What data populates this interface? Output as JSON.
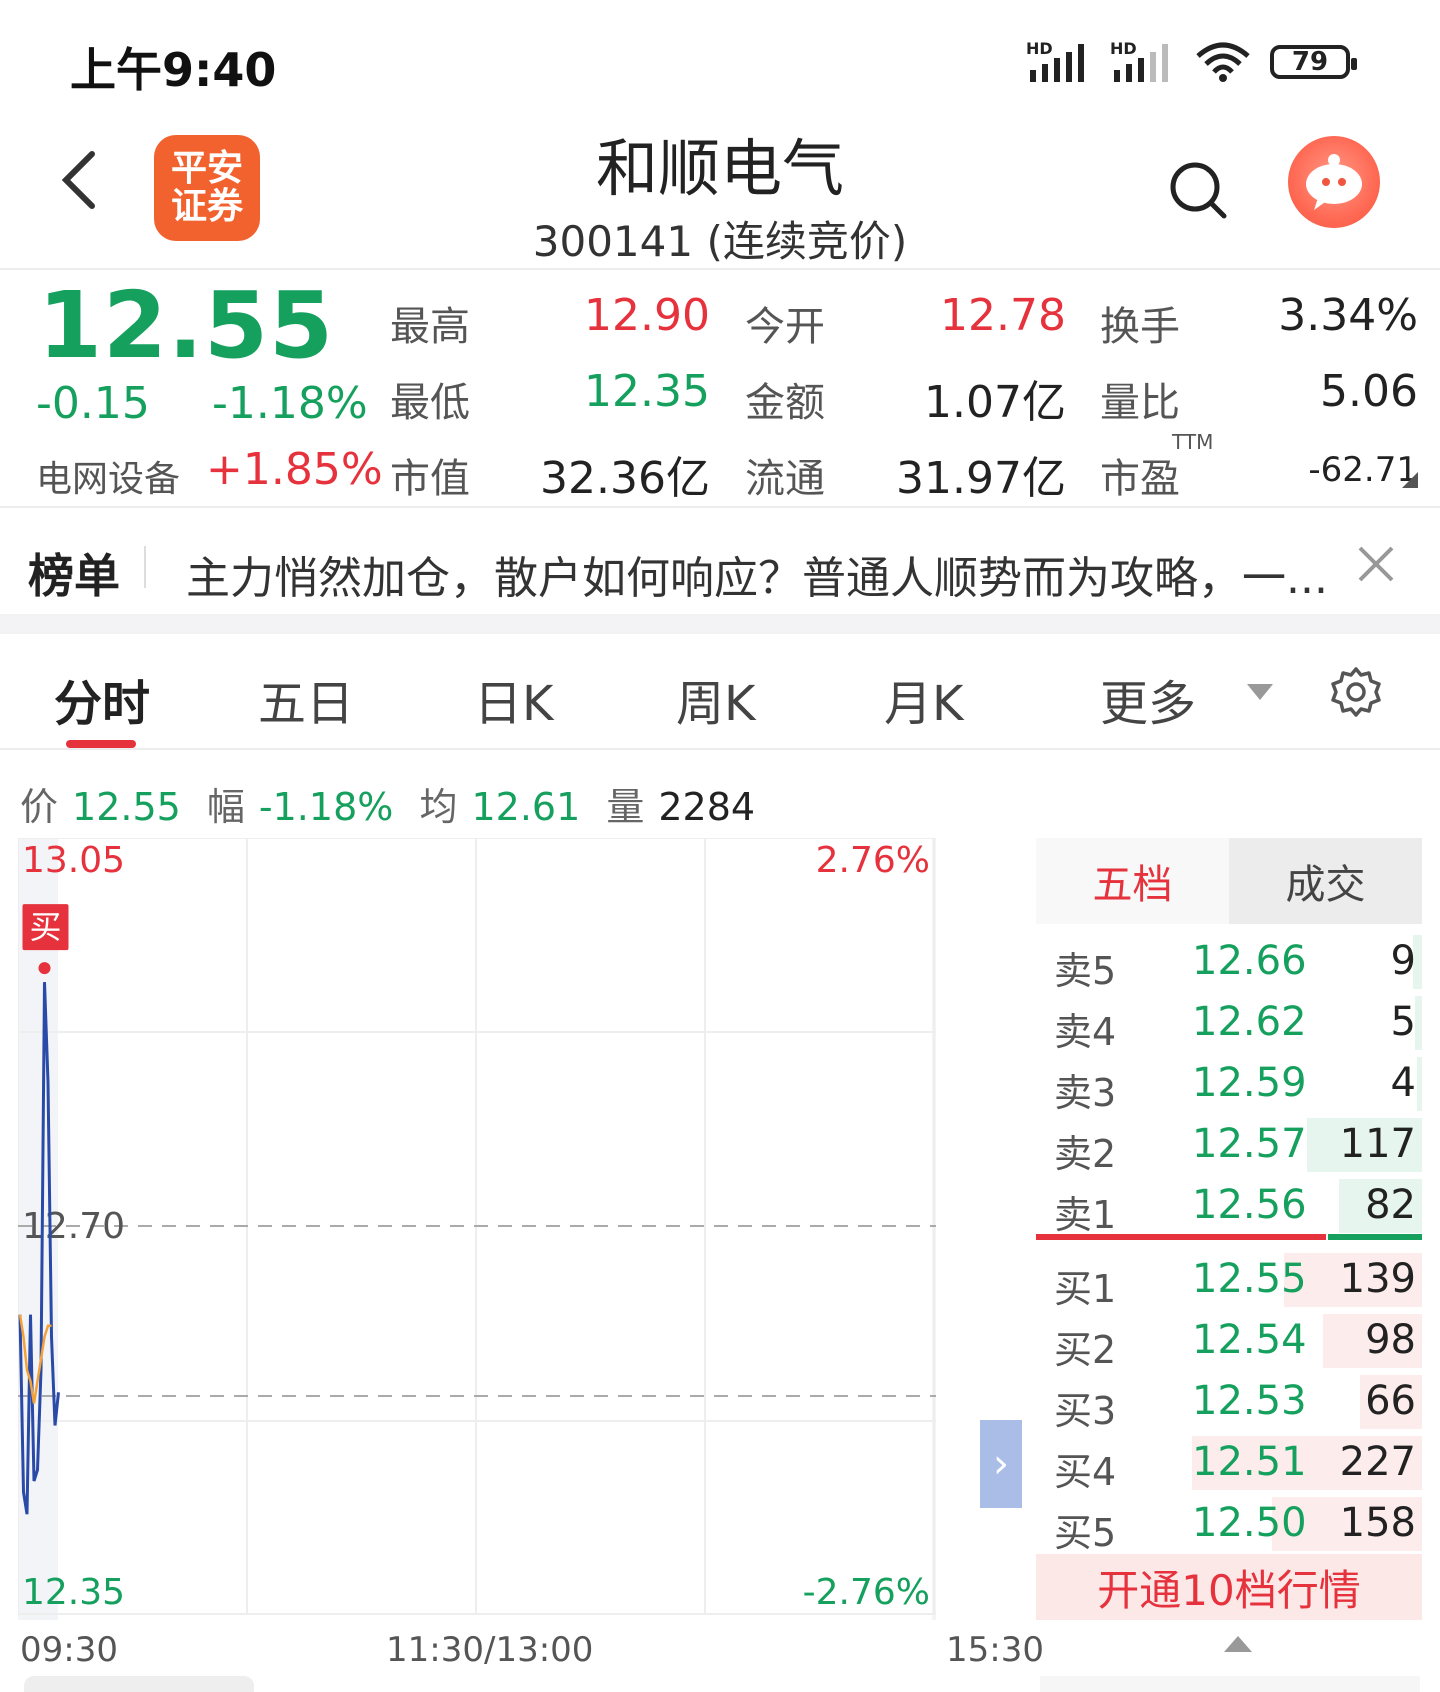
{
  "status": {
    "time": "上午9:40",
    "battery": "79",
    "sim1": "HD",
    "sim2": "HD"
  },
  "header": {
    "title": "和顺电气",
    "subtitle": "300141 (连续竞价)",
    "logo_line1": "平安",
    "logo_line2": "证券"
  },
  "quote": {
    "price": "12.55",
    "change": "-0.15",
    "change_pct": "-1.18%",
    "sector": "电网设备",
    "sector_pct": "+1.85%",
    "fields": [
      {
        "label": "最高",
        "value": "12.90",
        "color": "red"
      },
      {
        "label": "今开",
        "value": "12.78",
        "color": "red"
      },
      {
        "label": "换手",
        "value": "3.34%",
        "color": "dark"
      },
      {
        "label": "最低",
        "value": "12.35",
        "color": "green"
      },
      {
        "label": "金额",
        "value": "1.07亿",
        "color": "dark"
      },
      {
        "label": "量比",
        "value": "5.06",
        "color": "dark"
      },
      {
        "label": "市值",
        "value": "32.36亿",
        "color": "dark"
      },
      {
        "label": "流通",
        "value": "31.97亿",
        "color": "dark"
      },
      {
        "label": "市盈",
        "value": "-62.71",
        "color": "dark"
      }
    ],
    "ttm": "TTM"
  },
  "news": {
    "tag": "榜单",
    "text": "主力悄然加仓，散户如何响应？普通人顺势而为攻略，一..."
  },
  "tabs": [
    "分时",
    "五日",
    "日K",
    "周K",
    "月K",
    "更多"
  ],
  "info": {
    "price_label": "价",
    "price": "12.55",
    "range_label": "幅",
    "range": "-1.18%",
    "avg_label": "均",
    "avg": "12.61",
    "vol_label": "量",
    "vol": "2284"
  },
  "chart_data": {
    "type": "line",
    "title": "",
    "y_max_label": "13.05",
    "y_mid_label": "12.70",
    "y_min_label": "12.35",
    "pct_max_label": "2.76%",
    "pct_min_label": "-2.76%",
    "ylim": [
      12.35,
      13.05
    ],
    "x_labels": [
      "09:30",
      "11:30/13:00",
      "15:30"
    ],
    "buy_marker": "买",
    "series": [
      {
        "values": [
          12.62,
          12.46,
          12.44,
          12.62,
          12.47,
          12.48,
          12.57,
          12.92,
          12.83,
          12.6,
          12.52,
          12.55
        ]
      },
      {
        "values": [
          12.62,
          12.6,
          12.57,
          12.56,
          12.54,
          12.56,
          12.58,
          12.6,
          12.61,
          12.61
        ]
      }
    ]
  },
  "orderbook": {
    "tab_active": "五档",
    "tab_other": "成交",
    "asks": [
      {
        "label": "卖5",
        "price": "12.66",
        "vol": "9",
        "depth": 0.04
      },
      {
        "label": "卖4",
        "price": "12.62",
        "vol": "5",
        "depth": 0.03
      },
      {
        "label": "卖3",
        "price": "12.59",
        "vol": "4",
        "depth": 0.02
      },
      {
        "label": "卖2",
        "price": "12.57",
        "vol": "117",
        "depth": 0.5
      },
      {
        "label": "卖1",
        "price": "12.56",
        "vol": "82",
        "depth": 0.36
      }
    ],
    "bids": [
      {
        "label": "买1",
        "price": "12.55",
        "vol": "139",
        "depth": 0.6
      },
      {
        "label": "买2",
        "price": "12.54",
        "vol": "98",
        "depth": 0.43
      },
      {
        "label": "买3",
        "price": "12.53",
        "vol": "66",
        "depth": 0.27
      },
      {
        "label": "买4",
        "price": "12.51",
        "vol": "227",
        "depth": 1.0
      },
      {
        "label": "买5",
        "price": "12.50",
        "vol": "158",
        "depth": 0.65
      }
    ],
    "upgrade": "开通10档行情"
  }
}
